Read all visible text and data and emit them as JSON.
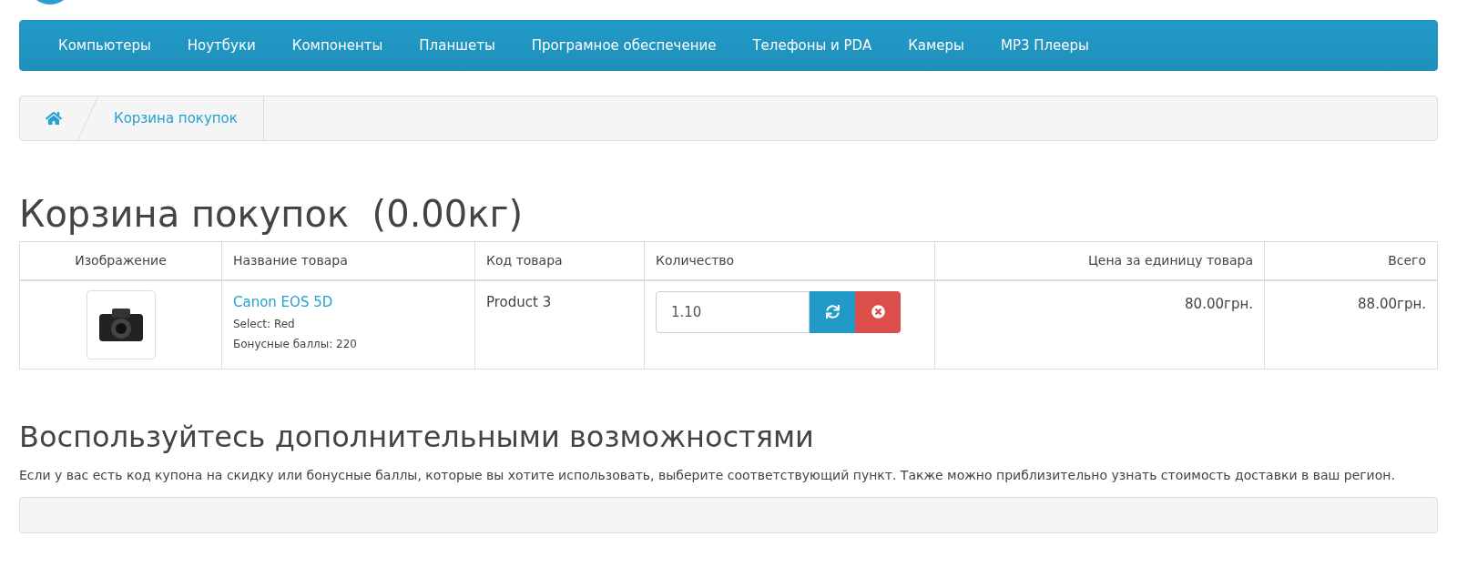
{
  "nav": {
    "items": [
      "Компьютеры",
      "Ноутбуки",
      "Компоненты",
      "Планшеты",
      "Програмное обеспечение",
      "Телефоны и PDA",
      "Камеры",
      "MP3 Плееры"
    ]
  },
  "breadcrumb": {
    "items": [
      "Корзина покупок"
    ]
  },
  "title": "Корзина покупок  (0.00кг)",
  "table": {
    "columns": [
      "Изображение",
      "Название товара",
      "Код товара",
      "Количество",
      "Цена за единицу товара",
      "Всего"
    ],
    "rows": [
      {
        "name": "Canon EOS 5D",
        "options": [
          "Select: Red",
          "Бонусные баллы: 220"
        ],
        "model": "Product 3",
        "quantity": "1.10",
        "price": "80.00грн.",
        "total": "88.00грн."
      }
    ]
  },
  "extras": {
    "title": "Воспользуйтесь дополнительными возможностями",
    "text": "Если у вас есть код купона на скидку или бонусные баллы, которые вы хотите использовать, выберите соответствующий пункт. Также можно приблизительно узнать стоимость доставки в ваш регион."
  }
}
